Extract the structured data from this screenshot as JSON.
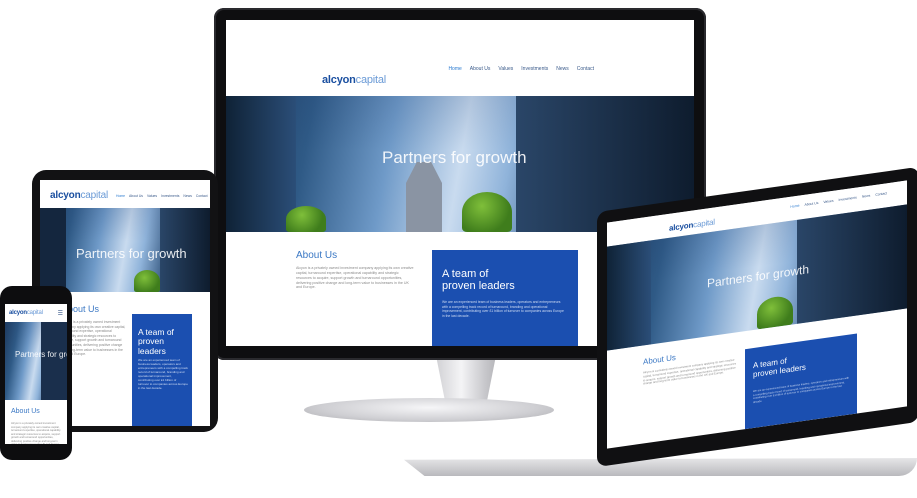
{
  "brand": {
    "logo_main": "alcyon",
    "logo_sub": "capital"
  },
  "nav": [
    "Home",
    "About Us",
    "Values",
    "Investments",
    "News",
    "Contact"
  ],
  "hero_text": "Partners for growth",
  "about": {
    "title": "About Us",
    "body": "Alcyon is a privately owned investment company applying its own creative capital, turnaround expertise, operational capability and strategic resources to acquire, support growth and turnaround opportunities, delivering positive change and long-term value to businesses in the UK and Europe."
  },
  "team": {
    "title_line1": "A team of",
    "title_line2": "proven leaders",
    "body": "We are an experienced team of business leaders, operators and entrepreneurs with a compelling track record of turnaround, branding and operational improvement, contributing over £1 billion of turnover to companies across Europe in the last decade."
  },
  "colors": {
    "brand_blue": "#1b4fb0",
    "accent_blue": "#3b78c4",
    "device_black": "#0e0e10"
  }
}
